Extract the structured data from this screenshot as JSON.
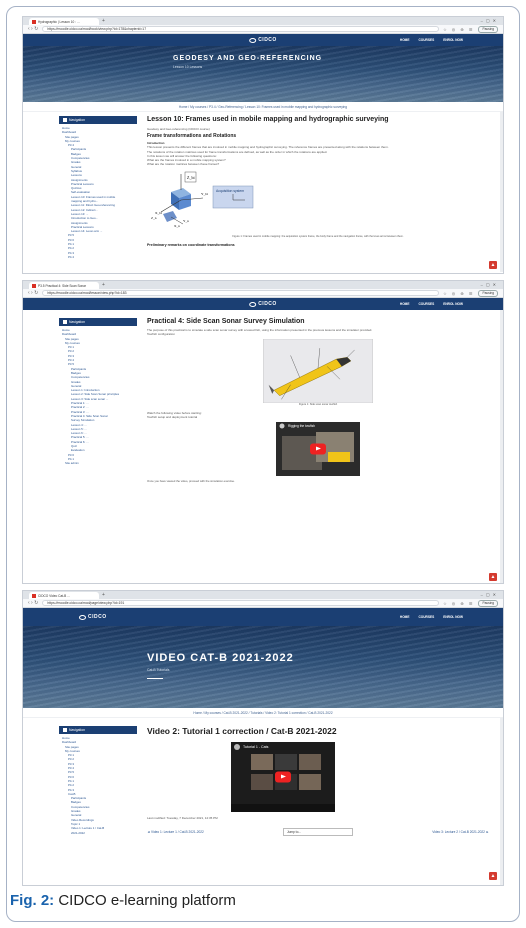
{
  "figure": {
    "caption_label": "Fig. 2:",
    "caption_text": " CIDCO e-learning platform"
  },
  "screens": [
    {
      "tab_title": "Hydrographic | Lesson 10 : ...",
      "url": "https://moodle.cidco.ca/mod/book/view.php?id=178&chapterid=17",
      "logo": "CIDCO",
      "nav": [
        "HOME",
        "COURSES",
        "ENROL NOW"
      ],
      "hero_title": "GEODESY AND GEO-REFERENCING",
      "hero_sub": "Lesson 10 Lessons",
      "breadcrumb": "Home / My courses / P3.4 / Geo-Referencing / Lesson 10: Frames used in mobile mapping and hydrographic surveying",
      "sidebar_head": "Navigation",
      "sidebar_items": [
        {
          "label": "Home",
          "lvl": "l0"
        },
        {
          "label": "Dashboard",
          "lvl": "l0"
        },
        {
          "label": "Site pages",
          "lvl": "l1"
        },
        {
          "label": "My courses",
          "lvl": "l1"
        },
        {
          "label": "P3.4",
          "lvl": "l2"
        },
        {
          "label": "Participants",
          "lvl": "l3"
        },
        {
          "label": "Badges",
          "lvl": "l3"
        },
        {
          "label": "Competencies",
          "lvl": "l3"
        },
        {
          "label": "Grades",
          "lvl": "l3"
        },
        {
          "label": "General",
          "lvl": "l3"
        },
        {
          "label": "Syllabus",
          "lvl": "l3"
        },
        {
          "label": "Lessons",
          "lvl": "l3"
        },
        {
          "label": "Assignments",
          "lvl": "l3"
        },
        {
          "label": "Practical Lessons",
          "lvl": "l3"
        },
        {
          "label": "Quizzes",
          "lvl": "l3"
        },
        {
          "label": "Self-evaluation",
          "lvl": "l3"
        },
        {
          "label": "Lesson 10: Frames used in mobile",
          "lvl": "l3"
        },
        {
          "label": "mapping and hydro...",
          "lvl": "l3"
        },
        {
          "label": "Lesson 11: Direct Geo-referencing",
          "lvl": "l3"
        },
        {
          "label": "Lesson 12: Indirect...",
          "lvl": "l3"
        },
        {
          "label": "Lesson 13: ...",
          "lvl": "l3"
        },
        {
          "label": "Introduction to Geo...",
          "lvl": "l3"
        },
        {
          "label": "Assignments",
          "lvl": "l3"
        },
        {
          "label": "Practical Lessons",
          "lvl": "l3"
        },
        {
          "label": "Lesson 14: Lever-arm ...",
          "lvl": "l3"
        },
        {
          "label": "P3.5",
          "lvl": "l2"
        },
        {
          "label": "P3.6",
          "lvl": "l2"
        },
        {
          "label": "P4.1",
          "lvl": "l2"
        },
        {
          "label": "P4.2",
          "lvl": "l2"
        },
        {
          "label": "P4.3",
          "lvl": "l2"
        },
        {
          "label": "P4.4",
          "lvl": "l2"
        }
      ],
      "content_title": "Lesson 10: Frames used in mobile mapping and hydrographic surveying",
      "content_meta": "Geodesy and Geo-referencing (CIDCO course)",
      "content_h2": "Frame transformations and Rotations",
      "content_h3": "Introduction",
      "content_lines": [
        "This lesson presents the different frames that are involved in mobile mapping and hydrographic surveying. The reference frames are presented along with the relations between them.",
        "The notations of the rotation matrices used for frame transformations are defined, as well as the order in which the rotations are applied.",
        "In this lesson we will answer the following questions:",
        "What are the frames involved in a mobile mapping system?",
        "What are the rotation matrices between these frames?"
      ],
      "figure_labels": [
        "Z_bi",
        "Y_bi",
        "X_bi",
        "Acquisition system",
        "Z_n",
        "Y_n",
        "X_n"
      ],
      "figure_caption": "Figure 1: Frames used in mobile mapping: the acquisition system frame, the body frame and the navigation frame, with the lever-arms between them.",
      "content_h4": "Preliminary remarks on coordinate transformations"
    },
    {
      "tab_title": "P3.5 Practical 4: Side Scan Sonar",
      "url": "https://moodle.cidco.ca/mod/lesson/view.php?id=183",
      "logo": "CIDCO",
      "nav": [
        "HOME",
        "COURSES",
        "ENROL NOW"
      ],
      "sidebar_head": "Navigation",
      "sidebar_items": [
        {
          "label": "Home",
          "lvl": "l0"
        },
        {
          "label": "Dashboard",
          "lvl": "l0"
        },
        {
          "label": "Site pages",
          "lvl": "l1"
        },
        {
          "label": "My courses",
          "lvl": "l1"
        },
        {
          "label": "P3.1",
          "lvl": "l2"
        },
        {
          "label": "P3.2",
          "lvl": "l2"
        },
        {
          "label": "P3.3",
          "lvl": "l2"
        },
        {
          "label": "P3.4",
          "lvl": "l2"
        },
        {
          "label": "P3.5",
          "lvl": "l2"
        },
        {
          "label": "Participants",
          "lvl": "l3"
        },
        {
          "label": "Badges",
          "lvl": "l3"
        },
        {
          "label": "Competencies",
          "lvl": "l3"
        },
        {
          "label": "Grades",
          "lvl": "l3"
        },
        {
          "label": "General",
          "lvl": "l3"
        },
        {
          "label": "Lesson 1: Introduction",
          "lvl": "l3"
        },
        {
          "label": "Lesson 2: Side Scan Sonar principles",
          "lvl": "l3"
        },
        {
          "label": "Lesson 3: Side scan sonar ...",
          "lvl": "l3"
        },
        {
          "label": "Practical 1: ...",
          "lvl": "l3"
        },
        {
          "label": "Practical 2: ...",
          "lvl": "l3"
        },
        {
          "label": "Practical 3: ...",
          "lvl": "l3"
        },
        {
          "label": "Practical 4: Side Scan Sonar",
          "lvl": "l3"
        },
        {
          "label": "Survey Simulation",
          "lvl": "l3"
        },
        {
          "label": "Lesson 4: ...",
          "lvl": "l3"
        },
        {
          "label": "Lesson 5: ...",
          "lvl": "l3"
        },
        {
          "label": "Lesson 6: ...",
          "lvl": "l3"
        },
        {
          "label": "Practical 5: ...",
          "lvl": "l3"
        },
        {
          "label": "Practical 6: ...",
          "lvl": "l3"
        },
        {
          "label": "Quiz",
          "lvl": "l3"
        },
        {
          "label": "Evaluation",
          "lvl": "l3"
        },
        {
          "label": "P3.6",
          "lvl": "l2"
        },
        {
          "label": "P4.1",
          "lvl": "l2"
        },
        {
          "label": "Site admin",
          "lvl": "l1"
        }
      ],
      "content_title": "Practical 4: Side Scan Sonar Survey Simulation",
      "content_lines": [
        "The purpose of this practical is to simulate a side scan sonar survey with a towed fish, using the information presented in the previous lessons and the simulator provided.",
        "Towfish configuration"
      ],
      "figure_caption": "Figure 1: Side scan sonar towfish",
      "content_lines2": [
        "Watch the following video before starting:",
        "Towfish setup and deployment tutorial"
      ],
      "video_title": "Rigging the towfish",
      "footer_line": "Once you have viewed the video, proceed with the simulation exercise."
    },
    {
      "tab_title": "CIDCO Video Cat-B ...",
      "url": "https://moodle.cidco.ca/mod/page/view.php?id=191",
      "logo": "CIDCO",
      "nav": [
        "HOME",
        "COURSES",
        "ENROL NOW"
      ],
      "hero_title": "VIDEO CAT-B 2021-2022",
      "hero_sub": "Cat-B Tutorials",
      "breadcrumb": "Home / My courses / Cat-B 2021-2022 / Tutorials / Video 2: Tutorial 1 correction / Cat-B 2021-2022",
      "sidebar_head": "Navigation",
      "sidebar_items": [
        {
          "label": "Home",
          "lvl": "l0"
        },
        {
          "label": "Dashboard",
          "lvl": "l0"
        },
        {
          "label": "Site pages",
          "lvl": "l1"
        },
        {
          "label": "My courses",
          "lvl": "l1"
        },
        {
          "label": "P3.1",
          "lvl": "l2"
        },
        {
          "label": "P3.2",
          "lvl": "l2"
        },
        {
          "label": "P3.3",
          "lvl": "l2"
        },
        {
          "label": "P3.4",
          "lvl": "l2"
        },
        {
          "label": "P3.5",
          "lvl": "l2"
        },
        {
          "label": "P3.6",
          "lvl": "l2"
        },
        {
          "label": "P4.1",
          "lvl": "l2"
        },
        {
          "label": "P4.2",
          "lvl": "l2"
        },
        {
          "label": "P4.3",
          "lvl": "l2"
        },
        {
          "label": "Cat-B",
          "lvl": "l2"
        },
        {
          "label": "Participants",
          "lvl": "l3"
        },
        {
          "label": "Badges",
          "lvl": "l3"
        },
        {
          "label": "Competencies",
          "lvl": "l3"
        },
        {
          "label": "Grades",
          "lvl": "l3"
        },
        {
          "label": "General",
          "lvl": "l3"
        },
        {
          "label": "Video Recordings",
          "lvl": "l3"
        },
        {
          "label": "Topic 1",
          "lvl": "l3"
        },
        {
          "label": "Video 1: Lecture 1 / Cat-B",
          "lvl": "l3"
        },
        {
          "label": "2021-2022",
          "lvl": "l3"
        }
      ],
      "content_title": "Video 2: Tutorial 1 correction / Cat-B 2021-2022",
      "video_title": "Tutorial 1 - Cats",
      "modified": "Last modified: Tuesday, 7 December 2021, 12:35 PM",
      "prev_link": "◄ Video 1: Lecture 1 / Cat-B 2021-2022",
      "jump_label": "Jump to...",
      "next_link": "Video 3: Lecture 2 / Cat-B 2021-2022 ►"
    }
  ]
}
